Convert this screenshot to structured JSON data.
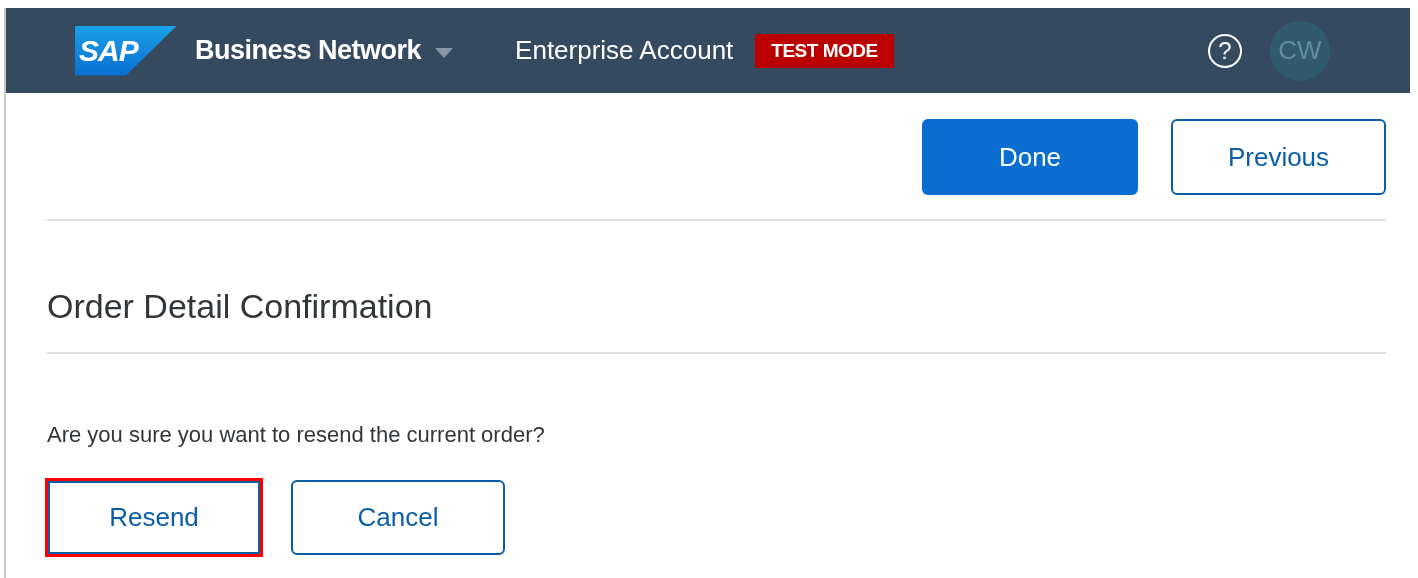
{
  "header": {
    "logo": "SAP",
    "product": "Business Network",
    "account": "Enterprise Account",
    "mode_badge": "TEST MODE",
    "help": "?",
    "avatar": "CW"
  },
  "toolbar": {
    "buttons": [
      {
        "label": "Done",
        "kind": "primary"
      },
      {
        "label": "Previous",
        "kind": "secondary"
      }
    ]
  },
  "section": {
    "title": "Order Detail Confirmation",
    "message": "Are you sure you want to resend the current order?",
    "buttons": [
      {
        "label": "Resend",
        "highlighted": true
      },
      {
        "label": "Cancel",
        "highlighted": false
      }
    ]
  }
}
